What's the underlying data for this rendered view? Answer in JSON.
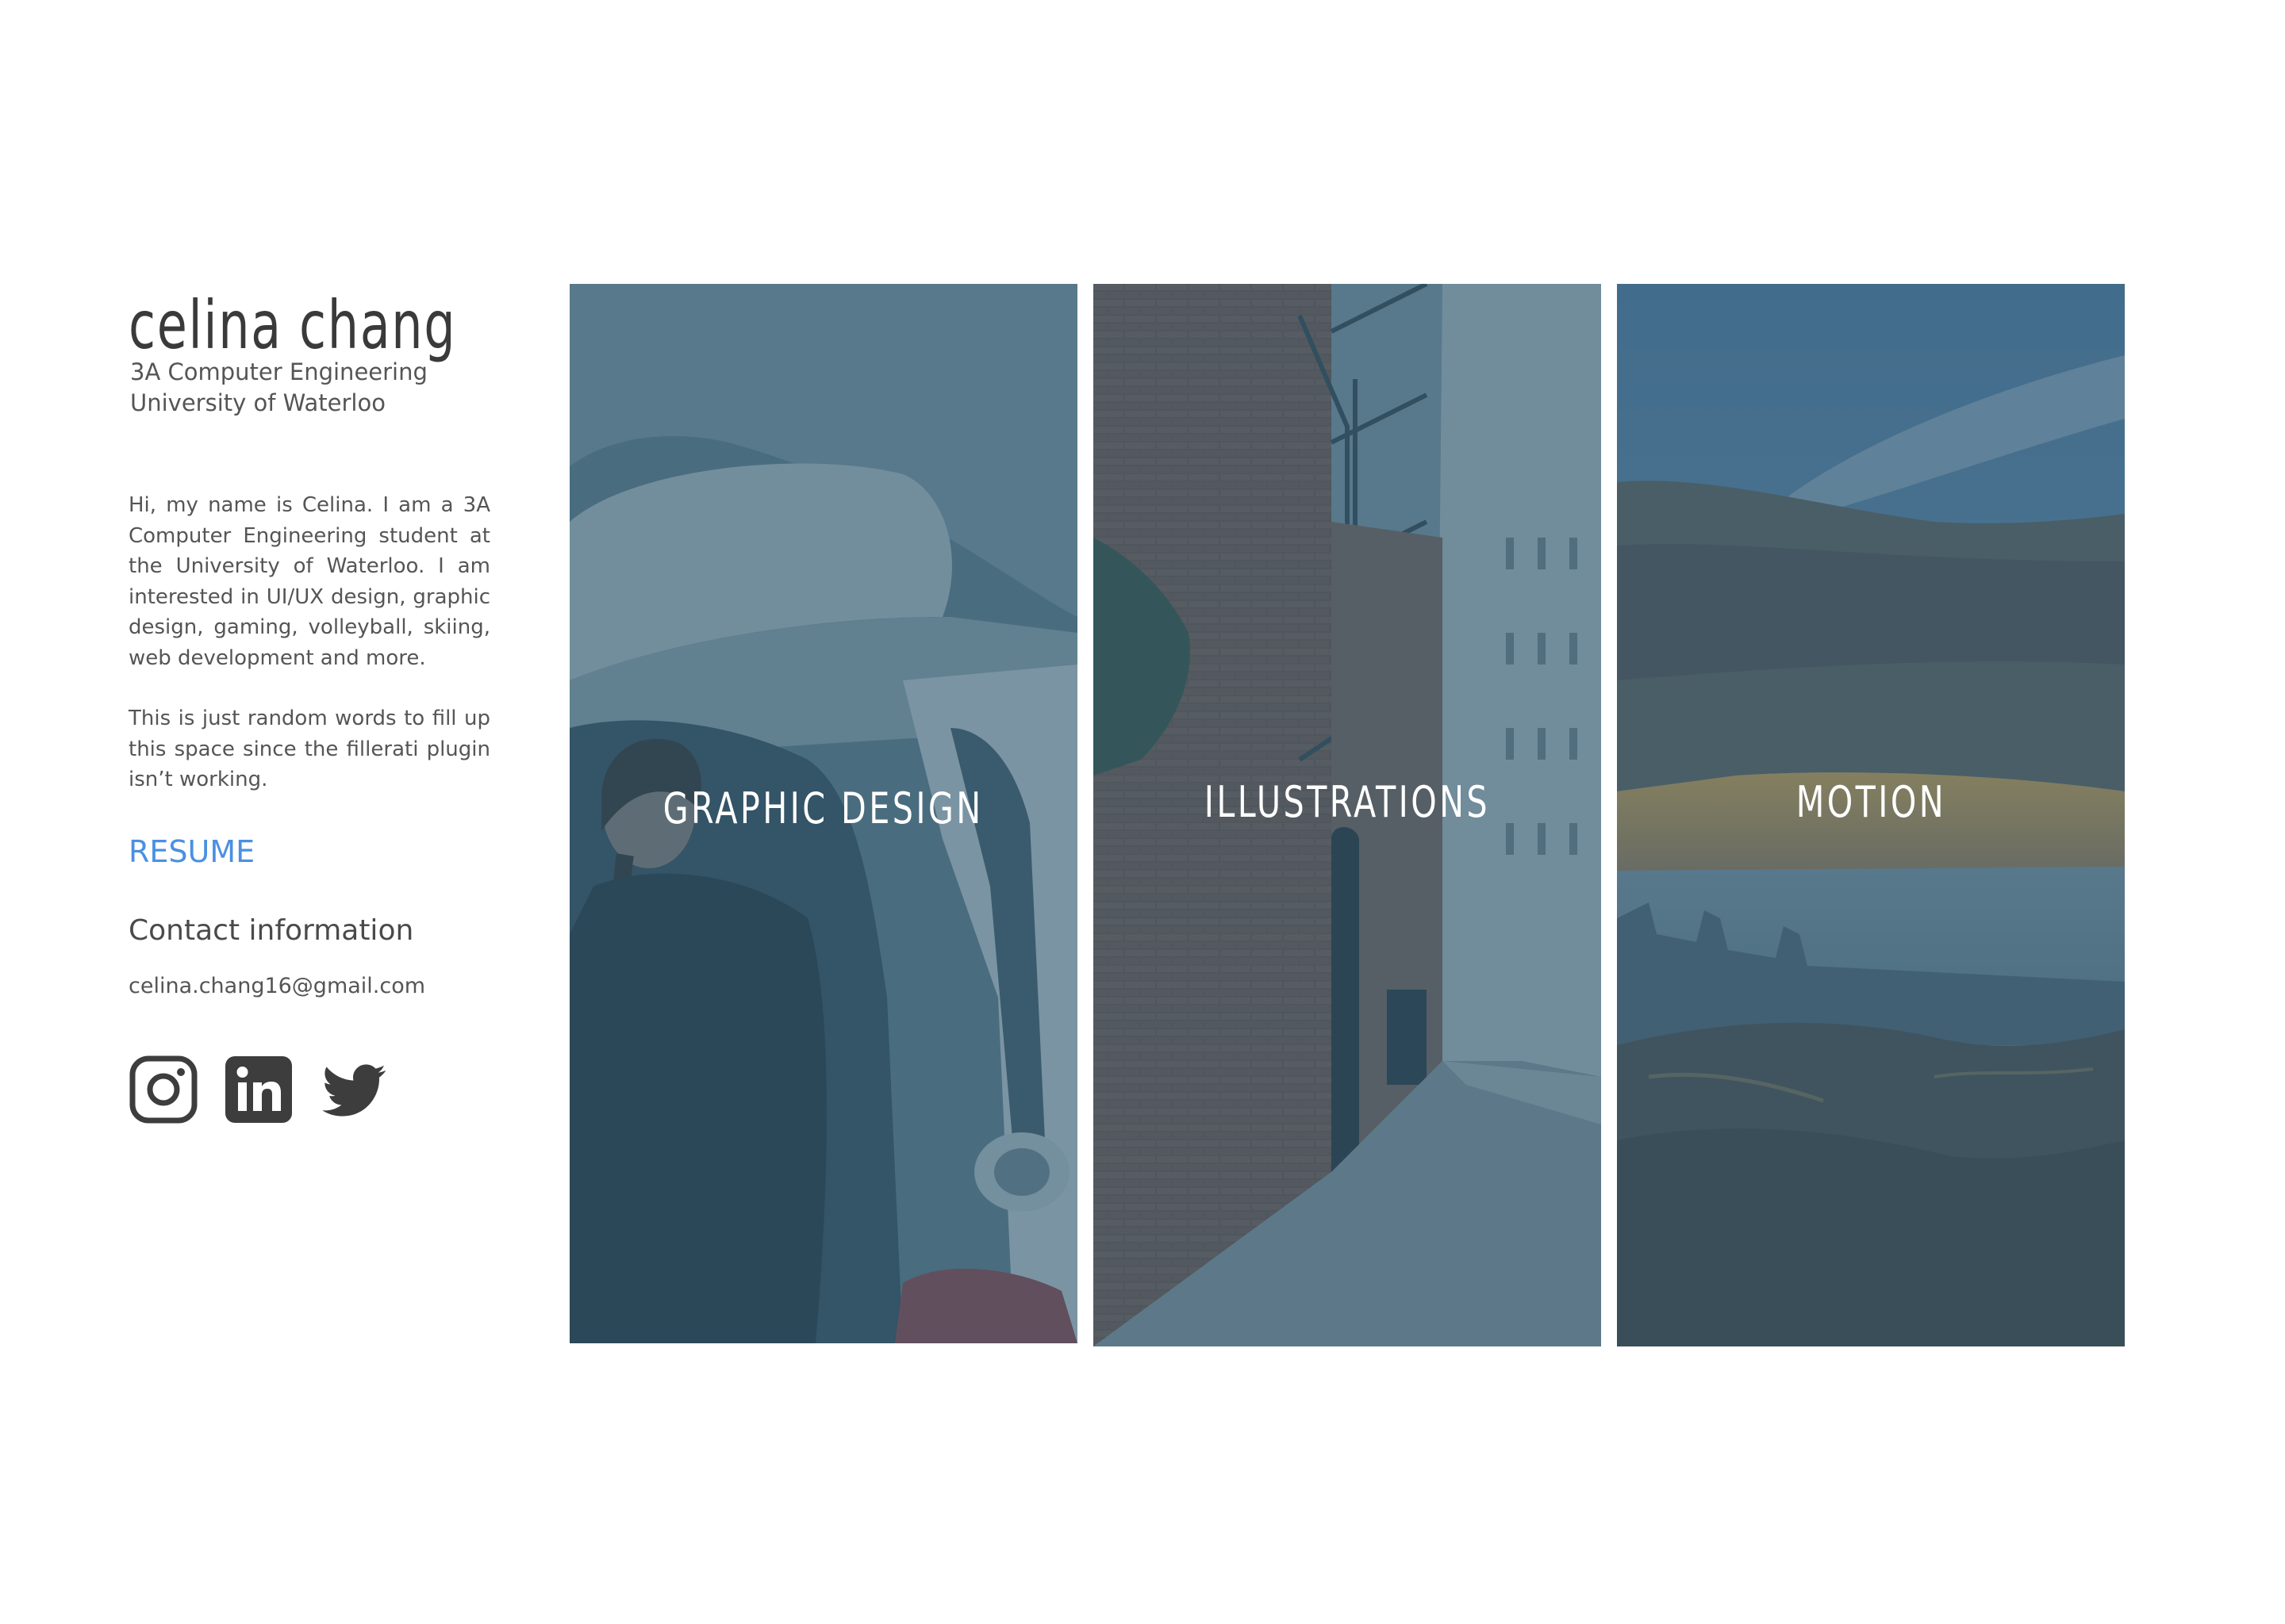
{
  "profile": {
    "name": "celina chang",
    "program": "3A Computer Engineering",
    "school": "University of Waterloo"
  },
  "bio": {
    "paragraph1": "Hi, my name is Celina. I am a 3A Computer Engineering student at the University of Waterloo. I am interested in UI/UX design, graphic design, gaming, volleyball, skiing, web development and more.",
    "paragraph2": "This is just random words to fill up this space since the fillerati plugin isn’t working."
  },
  "links": {
    "resume": "RESUME",
    "resume_color": "#4a90e2"
  },
  "contact": {
    "heading": "Contact information",
    "email": "celina.chang16@gmail.com"
  },
  "social": [
    {
      "icon": "instagram-icon"
    },
    {
      "icon": "linkedin-icon"
    },
    {
      "icon": "twitter-icon"
    }
  ],
  "panels": [
    {
      "label": "GRAPHIC DESIGN",
      "overlay_color": "#2c546c"
    },
    {
      "label": "ILLUSTRATIONS",
      "overlay_color": "#2c546c"
    },
    {
      "label": "MOTION",
      "overlay_color": "#2c546c"
    }
  ]
}
